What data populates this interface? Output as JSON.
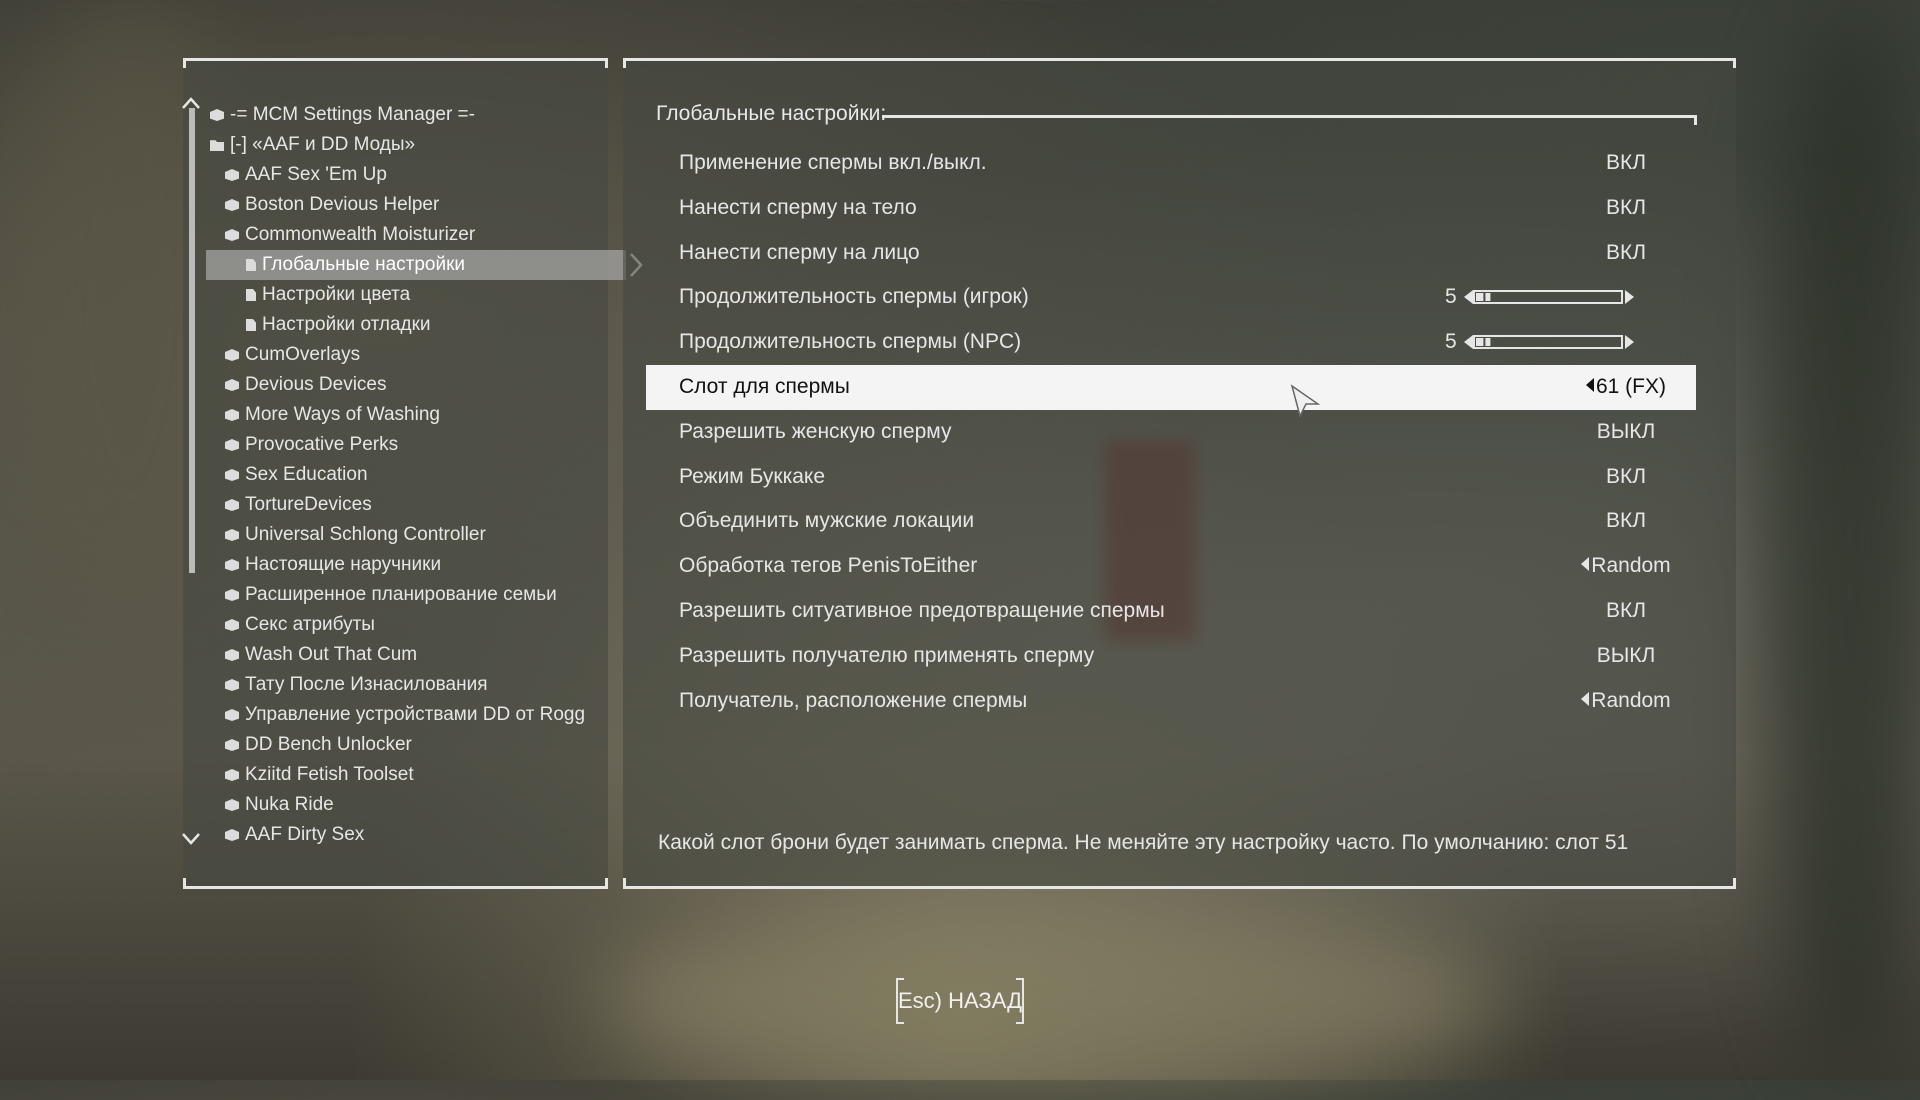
{
  "left_tree": {
    "items": [
      {
        "label": "-= MCM Settings Manager =-",
        "icon": "box-icon",
        "level": 0
      },
      {
        "label": "[-] «AAF и DD Моды»",
        "icon": "folder-icon",
        "level": 0
      },
      {
        "label": "AAF Sex 'Em Up",
        "icon": "box-icon",
        "level": 1
      },
      {
        "label": "Boston Devious Helper",
        "icon": "box-icon",
        "level": 1
      },
      {
        "label": "Commonwealth Moisturizer",
        "icon": "box-icon",
        "level": 1
      },
      {
        "label": "Глобальные настройки",
        "icon": "page-icon",
        "level": 2,
        "selected": true
      },
      {
        "label": "Настройки цвета",
        "icon": "page-icon",
        "level": 2
      },
      {
        "label": "Настройки отладки",
        "icon": "page-icon",
        "level": 2
      },
      {
        "label": "CumOverlays",
        "icon": "box-icon",
        "level": 1
      },
      {
        "label": "Devious Devices",
        "icon": "box-icon",
        "level": 1
      },
      {
        "label": "More Ways of Washing",
        "icon": "box-icon",
        "level": 1
      },
      {
        "label": "Provocative Perks",
        "icon": "box-icon",
        "level": 1
      },
      {
        "label": "Sex Education",
        "icon": "box-icon",
        "level": 1
      },
      {
        "label": "TortureDevices",
        "icon": "box-icon",
        "level": 1
      },
      {
        "label": "Universal Schlong Controller",
        "icon": "box-icon",
        "level": 1
      },
      {
        "label": "Настоящие наручники",
        "icon": "box-icon",
        "level": 1
      },
      {
        "label": "Расширенное планирование семьи",
        "icon": "box-icon",
        "level": 1
      },
      {
        "label": "Секс атрибуты",
        "icon": "box-icon",
        "level": 1
      },
      {
        "label": "Wash Out That Cum",
        "icon": "box-icon",
        "level": 1
      },
      {
        "label": "Тату После Изнасилования",
        "icon": "box-icon",
        "level": 1
      },
      {
        "label": "Управление устройствами DD от Rogg",
        "icon": "box-icon",
        "level": 1
      },
      {
        "label": "DD Bench Unlocker",
        "icon": "box-icon",
        "level": 1
      },
      {
        "label": "Kziitd Fetish Toolset",
        "icon": "box-icon",
        "level": 1
      },
      {
        "label": "Nuka Ride",
        "icon": "box-icon",
        "level": 1
      },
      {
        "label": "AAF Dirty Sex",
        "icon": "box-icon",
        "level": 1
      }
    ]
  },
  "settings": {
    "section_title": "Глобальные настройки:",
    "rows": [
      {
        "label": "Применение спермы вкл./выкл.",
        "value": "ВКЛ",
        "kind": "toggle"
      },
      {
        "label": "Нанести сперму на тело",
        "value": "ВКЛ",
        "kind": "toggle"
      },
      {
        "label": "Нанести сперму на лицо",
        "value": "ВКЛ",
        "kind": "toggle"
      },
      {
        "label": "Продолжительность спермы (игрок)",
        "value": "5",
        "kind": "slider",
        "fraction": 0.05
      },
      {
        "label": "Продолжительность спермы (NPC)",
        "value": "5",
        "kind": "slider",
        "fraction": 0.05
      },
      {
        "label": "Слот для спермы",
        "value": "61 (FX)",
        "kind": "list",
        "selected": true
      },
      {
        "label": "Разрешить женскую сперму",
        "value": "ВЫКЛ",
        "kind": "toggle"
      },
      {
        "label": "Режим Буккаке",
        "value": "ВКЛ",
        "kind": "toggle"
      },
      {
        "label": "Объединить мужские локации",
        "value": "ВКЛ",
        "kind": "toggle"
      },
      {
        "label": "Обработка тегов PenisToEither",
        "value": "Random",
        "kind": "list"
      },
      {
        "label": "Разрешить ситуативное предотвращение спермы",
        "value": "ВКЛ",
        "kind": "toggle"
      },
      {
        "label": "Разрешить получателю применять сперму",
        "value": "ВЫКЛ",
        "kind": "toggle"
      },
      {
        "label": "Получатель, расположение спермы",
        "value": "Random",
        "kind": "list"
      }
    ],
    "help_text": "Какой слот брони будет занимать сперма. Не меняйте эту настройку часто.  По умолчанию: слот 51"
  },
  "footer": {
    "back_label": "Esc) НАЗАД"
  },
  "colors": {
    "panel": "#46483f",
    "text": "#e6e6e6",
    "selected_row_bg": "#f4f4f4",
    "selected_row_text": "#111111"
  }
}
